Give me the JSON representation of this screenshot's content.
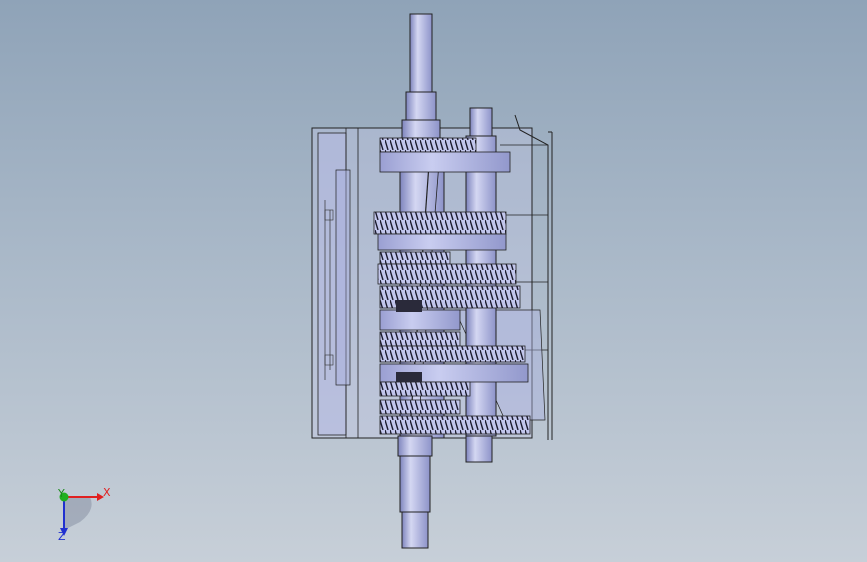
{
  "viewport": {
    "background_top": "#8fa3b8",
    "background_bottom": "#c7cfd8",
    "model": {
      "name_icon": "gearbox-assembly",
      "fill_color": "#b9bfe6",
      "shade_color": "#8d93c9",
      "edge_color": "#1a1a2a"
    }
  },
  "triad": {
    "x_label": "X",
    "y_label": "Y",
    "z_label": "Z",
    "x_color": "#e02020",
    "y_color": "#20b020",
    "z_color": "#2030d0"
  }
}
